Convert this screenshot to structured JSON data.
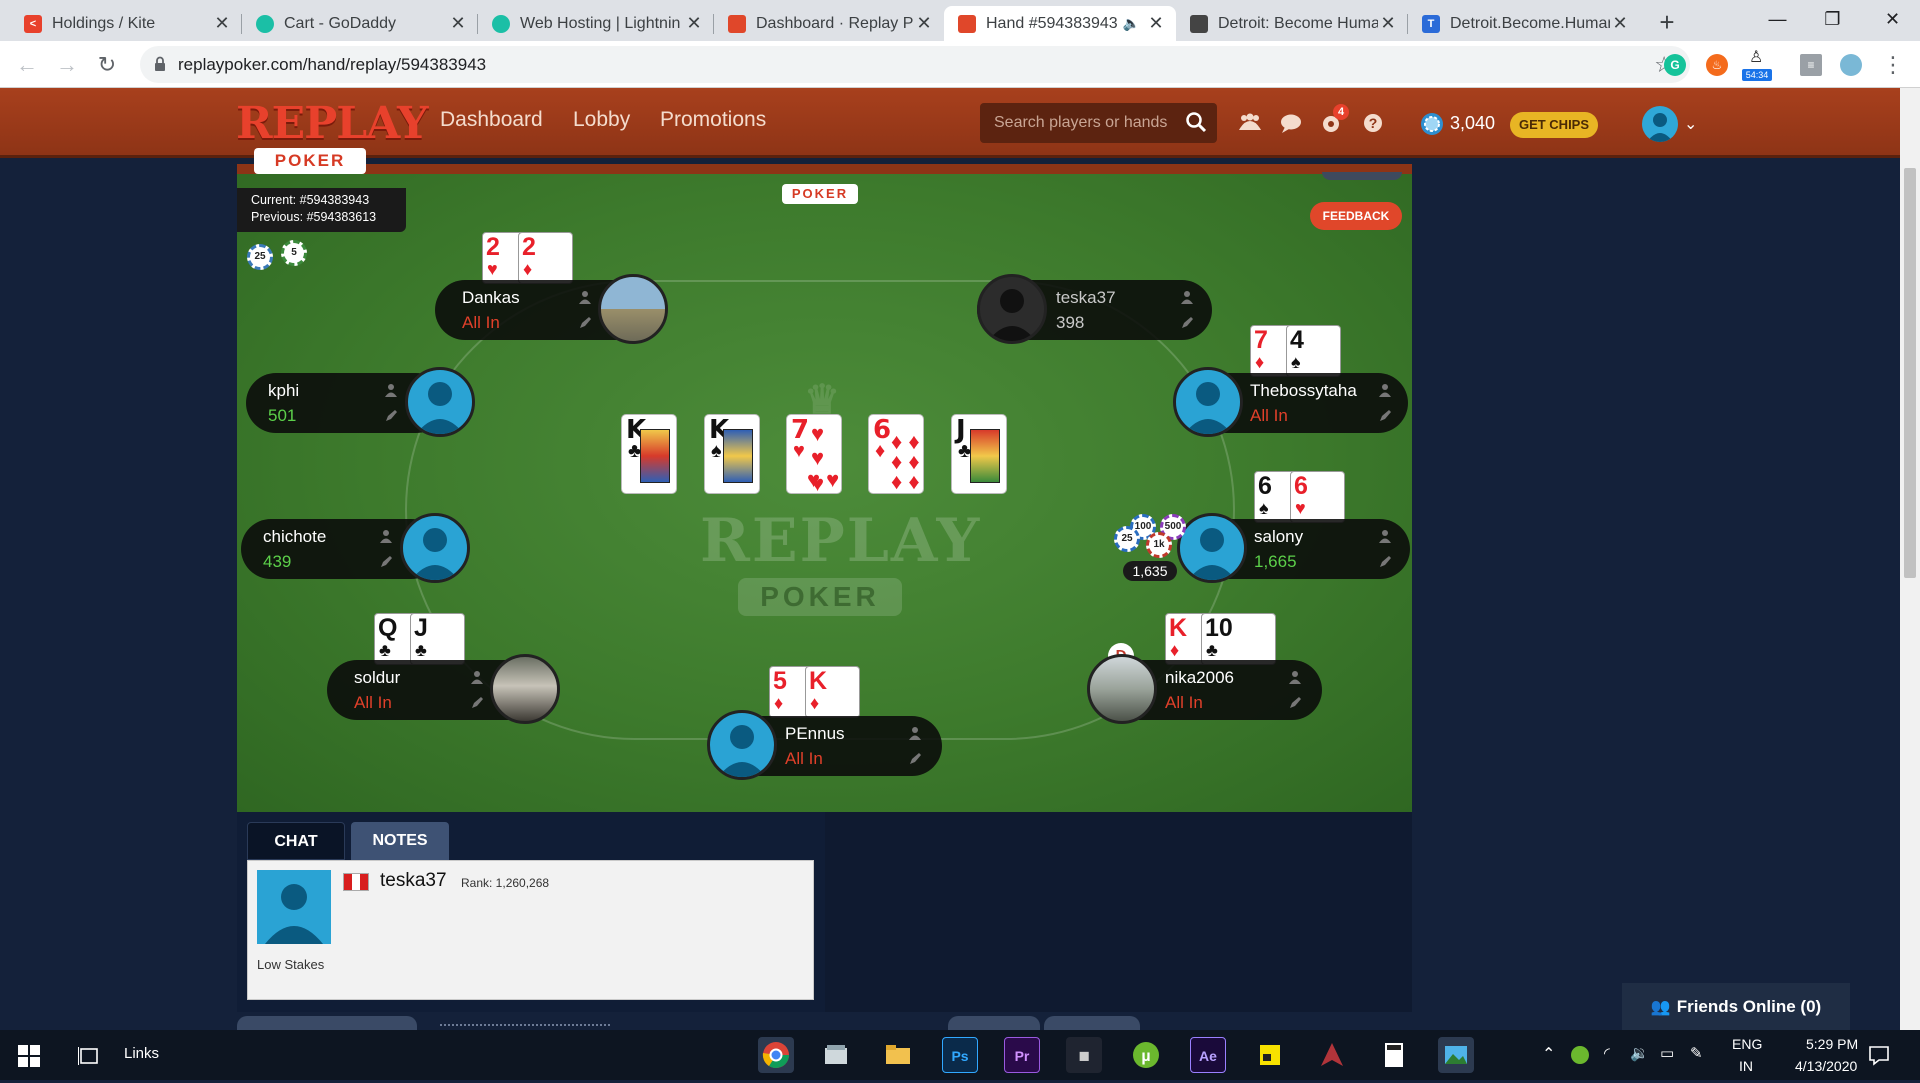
{
  "browser": {
    "tabs": [
      {
        "title": "Holdings / Kite",
        "color": "#e8412c"
      },
      {
        "title": "Cart - GoDaddy",
        "color": "#1bbfa6"
      },
      {
        "title": "Web Hosting | Lightnin",
        "color": "#1bbfa6"
      },
      {
        "title": "Dashboard · Replay Pol",
        "color": "#e0472a"
      },
      {
        "title": "Hand #594383943",
        "color": "#e0472a"
      },
      {
        "title": "Detroit: Become Huma",
        "color": "#444444"
      },
      {
        "title": "Detroit.Become.Human",
        "color": "#2b6bd8"
      }
    ],
    "url": "replaypoker.com/hand/replay/594383943",
    "ext_badge": "54:34"
  },
  "site": {
    "logo_main": "REPLAY",
    "logo_sub": "POKER",
    "nav": [
      "Dashboard",
      "Lobby",
      "Promotions"
    ],
    "search_placeholder": "Search players or hands",
    "notif_count": "4",
    "chips": "3,040",
    "get_chips": "GET CHIPS"
  },
  "table": {
    "current_hand": "Current: #594383943",
    "previous_hand": "Previous: #594383613",
    "feedback": "FEEDBACK",
    "ante_chips": [
      "25",
      "5"
    ],
    "community_cards": [
      {
        "rank": "K",
        "suit": "♣",
        "color": "black"
      },
      {
        "rank": "K",
        "suit": "♠",
        "color": "black"
      },
      {
        "rank": "7",
        "suit": "♥",
        "color": "red"
      },
      {
        "rank": "6",
        "suit": "♦",
        "color": "red"
      },
      {
        "rank": "J",
        "suit": "♣",
        "color": "black"
      }
    ],
    "pot": "1,635",
    "pot_chips": [
      "100",
      "500",
      "25",
      "1k"
    ],
    "dealer": "D",
    "watermark_main": "REPLAY",
    "watermark_sub": "POKER"
  },
  "players": [
    {
      "name": "Dankas",
      "status": "All In",
      "cards": [
        {
          "rank": "2",
          "suit": "♥"
        },
        {
          "rank": "2",
          "suit": "♦"
        }
      ]
    },
    {
      "name": "teska37",
      "status": "398",
      "cards": []
    },
    {
      "name": "kphi",
      "status": "501",
      "cards": []
    },
    {
      "name": "Thebossytaha",
      "status": "All In",
      "cards": [
        {
          "rank": "7",
          "suit": "♦"
        },
        {
          "rank": "4",
          "suit": "♠"
        }
      ]
    },
    {
      "name": "chichote",
      "status": "439",
      "cards": []
    },
    {
      "name": "salony",
      "status": "1,665",
      "cards": [
        {
          "rank": "6",
          "suit": "♠"
        },
        {
          "rank": "6",
          "suit": "♥"
        }
      ]
    },
    {
      "name": "soldur",
      "status": "All In",
      "cards": [
        {
          "rank": "Q",
          "suit": "♣"
        },
        {
          "rank": "J",
          "suit": "♣"
        }
      ]
    },
    {
      "name": "nika2006",
      "status": "All In",
      "cards": [
        {
          "rank": "K",
          "suit": "♦"
        },
        {
          "rank": "10",
          "suit": "♣"
        }
      ]
    },
    {
      "name": "PEnnus",
      "status": "All In",
      "cards": [
        {
          "rank": "5",
          "suit": "♦"
        },
        {
          "rank": "K",
          "suit": "♦"
        }
      ]
    }
  ],
  "chat": {
    "tab_chat": "CHAT",
    "tab_notes": "NOTES",
    "username": "teska37",
    "rank": "Rank: 1,260,268",
    "stakes": "Low Stakes"
  },
  "friends": "Friends Online (0)",
  "taskbar": {
    "links": "Links",
    "lang1": "ENG",
    "lang2": "IN",
    "time": "5:29 PM",
    "date": "4/13/2020"
  }
}
